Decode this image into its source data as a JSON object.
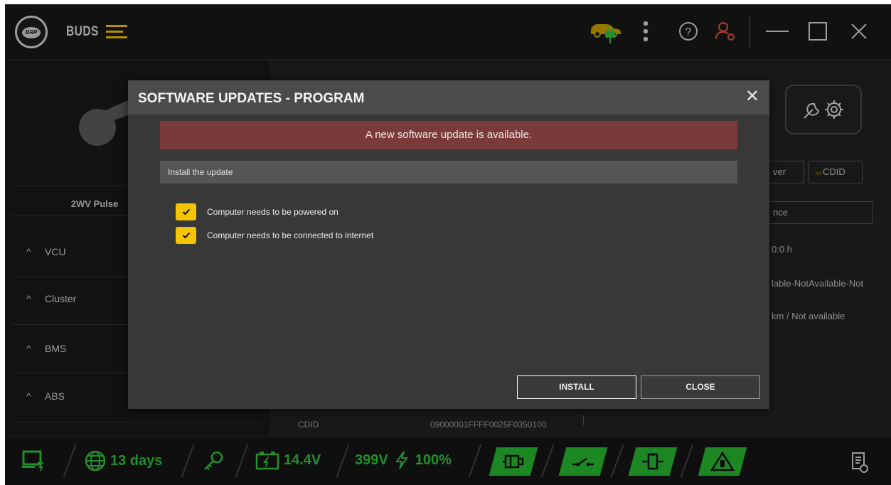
{
  "app": {
    "name": "BUDS",
    "logo_text": "BRP"
  },
  "left_panel": {
    "model": "2WV Pulse",
    "modules": [
      "VCU",
      "Cluster",
      "BMS",
      "ABS"
    ]
  },
  "right_panel": {
    "buttons": [
      "ver",
      "CDID"
    ],
    "field": "nce",
    "values": [
      "0:0 h",
      "lable-NotAvailable-Not",
      "km / Not available"
    ],
    "cdid_label": "CDID",
    "cdid_value": "09000001FFFF0025F0350100"
  },
  "status_bar": {
    "license": "13 days",
    "battery_12v": "14.4V",
    "battery_hv": "399V",
    "charge": "100%"
  },
  "dialog": {
    "title": "SOFTWARE UPDATES - PROGRAM",
    "banner": "A new software update is available.",
    "section": "Install the update",
    "checks": [
      "Computer needs to be powered on",
      "Computer needs to be connected to internet"
    ],
    "install_label": "INSTALL",
    "close_label": "CLOSE"
  },
  "colors": {
    "accent": "#f5c400",
    "status_green": "#27b531",
    "banner_red": "#7b3a3a",
    "user_icon_red": "#e0533e"
  }
}
